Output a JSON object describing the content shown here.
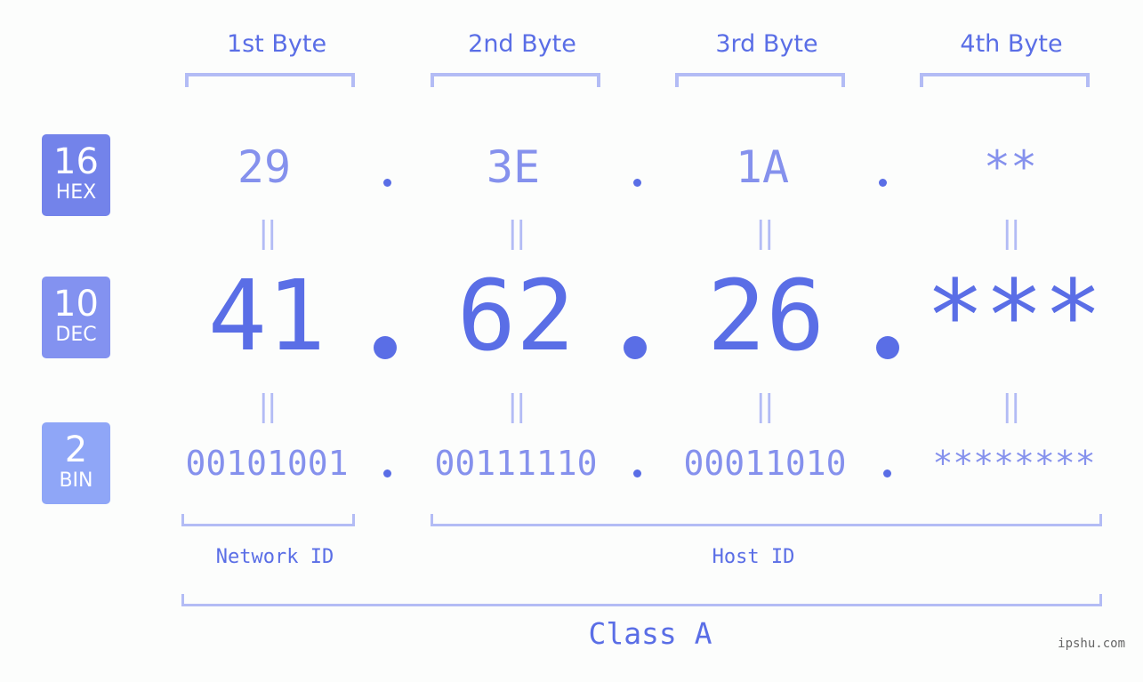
{
  "rows": {
    "hex": {
      "base": "16",
      "label": "HEX",
      "color": "#7383ea"
    },
    "dec": {
      "base": "10",
      "label": "DEC",
      "color": "#8392f0"
    },
    "bin": {
      "base": "2",
      "label": "BIN",
      "color": "#8fa6f7"
    }
  },
  "bytes": [
    {
      "header": "1st Byte",
      "hex": "29",
      "dec": "41",
      "bin": "00101001"
    },
    {
      "header": "2nd Byte",
      "hex": "3E",
      "dec": "62",
      "bin": "00111110"
    },
    {
      "header": "3rd Byte",
      "hex": "1A",
      "dec": "26",
      "bin": "00011010"
    },
    {
      "header": "4th Byte",
      "hex": "**",
      "dec": "***",
      "bin": "********"
    }
  ],
  "equals_symbol": "||",
  "network_id_label": "Network ID",
  "host_id_label": "Host ID",
  "class_label": "Class A",
  "watermark": "ipshu.com",
  "colors": {
    "accent": "#5a6ee6",
    "light_value": "#8591ed",
    "bracket": "#b3bcf5",
    "background": "#fcfdfc"
  }
}
